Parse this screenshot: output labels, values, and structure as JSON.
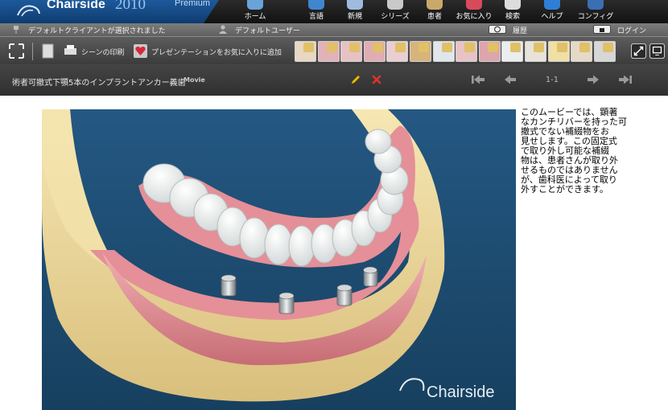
{
  "brand": {
    "name": "Chairside",
    "year": "2010",
    "edition": "Premium"
  },
  "nav": [
    {
      "label": "ホーム",
      "icon": "chair-icon",
      "color": "#6aa3d8"
    },
    {
      "label": "言語",
      "icon": "globe-icon",
      "color": "#3f86cf"
    },
    {
      "label": "新規",
      "icon": "new-doc-icon",
      "color": "#9fbbe0"
    },
    {
      "label": "シリーズ",
      "icon": "film-icon",
      "color": "#c9c9c9"
    },
    {
      "label": "患者",
      "icon": "patient-icon",
      "color": "#caa86a"
    },
    {
      "label": "お気に入り",
      "icon": "heart-icon",
      "color": "#d94a5a"
    },
    {
      "label": "検索",
      "icon": "search-icon",
      "color": "#dcdcdc"
    },
    {
      "label": "ヘルプ",
      "icon": "help-icon",
      "color": "#2f7fd6"
    },
    {
      "label": "コンフィグ",
      "icon": "gear-icon",
      "color": "#3b6fb4"
    }
  ],
  "status": {
    "client": "デフォルトクライアントが選択されました",
    "user": "デフォルトユーザー",
    "history": "履歴",
    "login": "ログイン"
  },
  "toolbar": {
    "print_scene": "シーンの印刷",
    "add_favorite": "プレゼンテーションをお気に入りに追加"
  },
  "scene_thumbnails": [
    {
      "name": "extraction",
      "color": "#e8d7c4"
    },
    {
      "name": "crown",
      "color": "#e2b2b8"
    },
    {
      "name": "bridge",
      "color": "#e7c2c5"
    },
    {
      "name": "ortho",
      "color": "#e0adb3"
    },
    {
      "name": "veneer",
      "color": "#e9cfd2"
    },
    {
      "name": "root-canal",
      "color": "#d8b37c"
    },
    {
      "name": "implant",
      "color": "#dfe6ec"
    },
    {
      "name": "periodontal",
      "color": "#e7c3c6"
    },
    {
      "name": "whitening",
      "color": "#dda5ad"
    },
    {
      "name": "denture",
      "color": "#ebeeef"
    },
    {
      "name": "surgery",
      "color": "#e8e2d8"
    },
    {
      "name": "sealant",
      "color": "#f0dfa6"
    },
    {
      "name": "hygiene",
      "color": "#e6d9c7"
    },
    {
      "name": "xray",
      "color": "#d7d7d7"
    }
  ],
  "movie": {
    "title": "術者可撤式下顎5本のインプラントアンカー義歯",
    "type": "Movie",
    "page": "1-1",
    "watermark": "Chairside",
    "description_lines": [
      "このムービーでは、顕著",
      "なカンチリバーを持った可",
      "撤式でない補綴物をお",
      "見せします。この固定式",
      "で取り外し可能な補綴",
      "物は、患者さんが取り外",
      "せるものではありません",
      "が、歯科医によって取り",
      "外すことができます。"
    ]
  },
  "colors": {
    "brand_blue": "#164b86",
    "video_background": "#1f4b72",
    "gum": "#e08f94",
    "bone": "#f1dfa3",
    "edit_pencil": "#f2c200",
    "delete_x": "#e0342b"
  }
}
